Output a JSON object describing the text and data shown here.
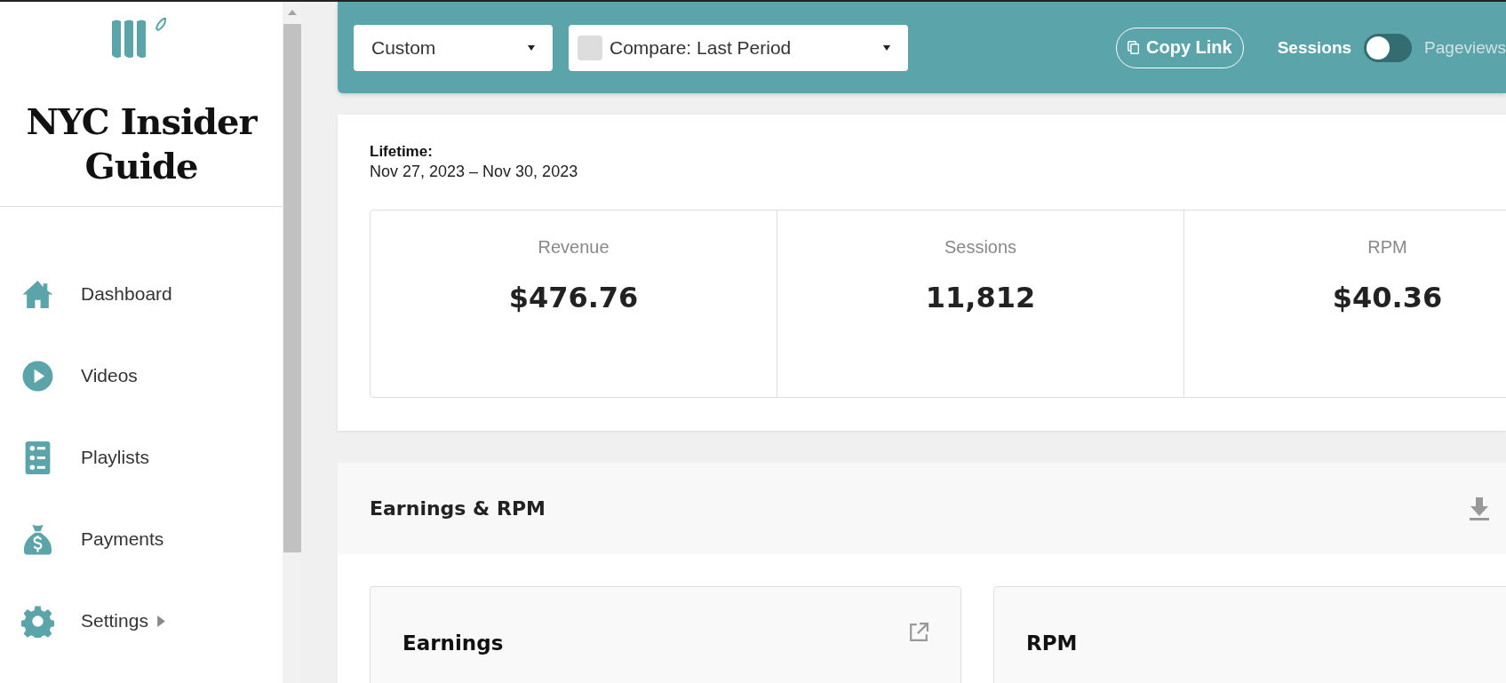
{
  "sidebar": {
    "site_name": "NYC Insider Guide",
    "items": [
      {
        "label": "Dashboard",
        "has_submenu": false
      },
      {
        "label": "Videos",
        "has_submenu": false
      },
      {
        "label": "Playlists",
        "has_submenu": false
      },
      {
        "label": "Payments",
        "has_submenu": false
      },
      {
        "label": "Settings",
        "has_submenu": true
      }
    ]
  },
  "toolbar": {
    "range": "Custom",
    "compare": {
      "label": "Compare: Last Period",
      "checked": false
    },
    "copy_link": "Copy Link",
    "metric_toggle": [
      {
        "label": "Sessions",
        "selected": true
      },
      {
        "label": "Pageviews",
        "selected": false
      }
    ]
  },
  "summary": {
    "title": "Lifetime:",
    "dates": "Nov 27, 2023 – Nov 30, 2023",
    "stats": [
      {
        "label": "Revenue",
        "value": "$476.76"
      },
      {
        "label": "Sessions",
        "value": "11,812"
      },
      {
        "label": "RPM",
        "value": "$40.36"
      }
    ]
  },
  "section": {
    "title": "Earnings & RPM",
    "cards": [
      {
        "title": "Earnings",
        "expandable": true
      },
      {
        "title": "RPM",
        "expandable": false
      }
    ]
  }
}
